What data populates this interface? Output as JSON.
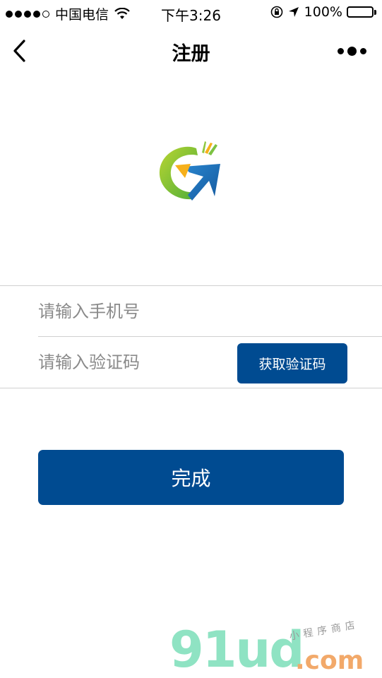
{
  "status_bar": {
    "carrier": "中国电信",
    "time": "下午3:26",
    "battery": "100%",
    "battery_level": 1.0
  },
  "nav": {
    "title": "注册",
    "back_icon": "chevron-left-icon",
    "more_icon": "more-dots-icon"
  },
  "logo": {
    "icon": "g-arrow-logo",
    "colors": {
      "green": "#7cc242",
      "yellow": "#f6b01b",
      "blue": "#1f6fb8"
    }
  },
  "form": {
    "phone_placeholder": "请输入手机号",
    "code_placeholder": "请输入验证码",
    "get_code_label": "获取验证码",
    "submit_label": "完成"
  },
  "colors": {
    "primary": "#004b91",
    "placeholder": "#8a8a8a",
    "divider": "#d0d0d0"
  },
  "watermark": {
    "brand": "91ud",
    "domain": ".com",
    "tagline": "小程序商店"
  }
}
